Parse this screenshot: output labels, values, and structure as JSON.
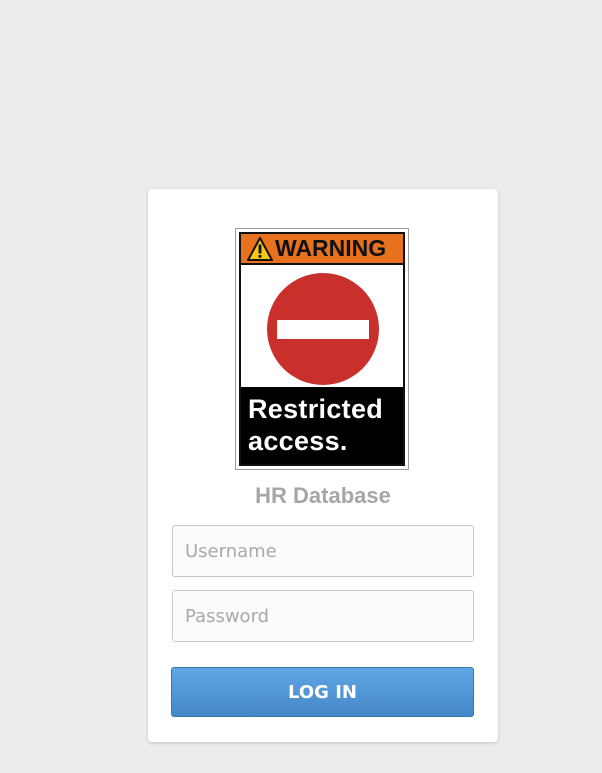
{
  "sign": {
    "header_text": "WARNING",
    "footer_line1": "Restricted",
    "footer_line2": "access.",
    "header_color": "#e8711d",
    "symbol_color": "#c9302c",
    "footer_color": "#000000"
  },
  "app": {
    "title": "HR Database"
  },
  "form": {
    "username_placeholder": "Username",
    "username_value": "",
    "password_placeholder": "Password",
    "password_value": "",
    "submit_label": "LOG IN",
    "button_color": "#4f97d8"
  }
}
